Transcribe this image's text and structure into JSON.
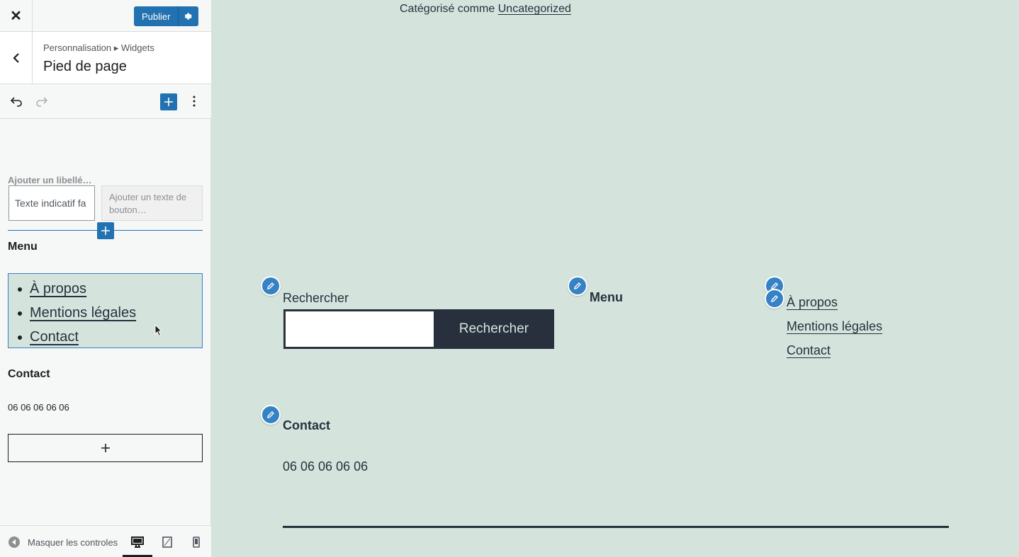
{
  "topbar": {
    "close_icon": "close-icon",
    "publish_label": "Publier",
    "settings_icon": "gear-icon"
  },
  "panel": {
    "breadcrumb": "Personnalisation ▸ Widgets",
    "title": "Pied de page",
    "back_icon": "chevron-left-icon"
  },
  "toolbar": {
    "undo_icon": "undo-icon",
    "redo_icon": "redo-icon",
    "add_icon": "plus-icon",
    "more_icon": "more-vertical-icon"
  },
  "editor": {
    "search_block": {
      "label_placeholder": "Ajouter un libellé…",
      "input_placeholder": "Texte indicatif fa",
      "button_placeholder": "Ajouter un texte de bouton…"
    },
    "menu_heading": "Menu",
    "menu_items": [
      "À propos",
      "Mentions légales",
      "Contact"
    ],
    "contact_heading": "Contact",
    "phone": "06 06 06 06 06",
    "add_block_icon": "plus-icon"
  },
  "footer": {
    "collapse_label": "Masquer les controles",
    "devices": [
      "desktop-icon",
      "tablet-icon",
      "mobile-icon"
    ],
    "active_device": "desktop"
  },
  "preview": {
    "categorized_prefix": "Catégorisé comme",
    "categorized_link": "Uncategorized",
    "search_label": "Rechercher",
    "search_button": "Rechercher",
    "menu_heading": "Menu",
    "menu_items": [
      "À propos",
      "Mentions légales",
      "Contact"
    ],
    "contact_heading": "Contact",
    "phone": "06 06 06 06 06"
  },
  "colors": {
    "accent": "#2271b1",
    "preview_bg": "#d4e4dd",
    "text_dark": "#28303d",
    "sidebar_bg": "#f6f7f7"
  }
}
